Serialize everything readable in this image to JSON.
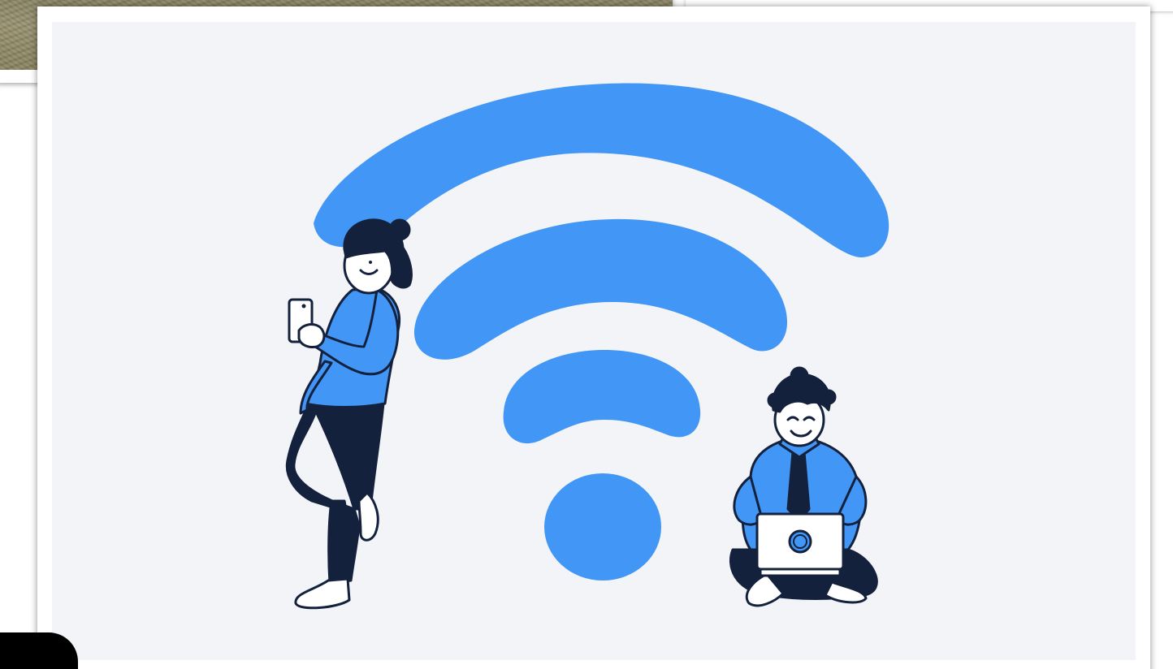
{
  "illustration": {
    "subject": "wifi-icon",
    "figures": [
      "person-standing-with-phone",
      "person-sitting-with-laptop"
    ],
    "colors": {
      "wifi_blue": "#4296f5",
      "outline_navy": "#14213d",
      "background": "#f2f4f7",
      "card": "#ffffff"
    }
  },
  "background_photo": {
    "colors": {
      "grass": "#8f8a6a"
    }
  }
}
